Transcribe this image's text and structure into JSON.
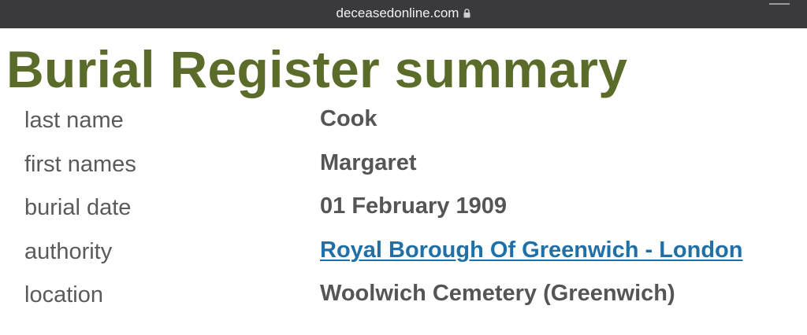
{
  "browser": {
    "url": "deceasedonline.com",
    "lock_icon": "lock-icon"
  },
  "page": {
    "title": "Burial Register summary"
  },
  "summary": {
    "rows": [
      {
        "label": "last name",
        "value": "Cook"
      },
      {
        "label": "first names",
        "value": "Margaret"
      },
      {
        "label": "burial date",
        "value": "01 February 1909"
      },
      {
        "label": "authority",
        "value": "Royal Borough Of Greenwich - London"
      },
      {
        "label": "location",
        "value": "Woolwich Cemetery (Greenwich)"
      }
    ]
  },
  "colors": {
    "title": "#5b6b2a",
    "label": "#5a5a5a",
    "value": "#555555",
    "link": "#1f6fa8",
    "browser_bar": "#3a3a3c"
  }
}
